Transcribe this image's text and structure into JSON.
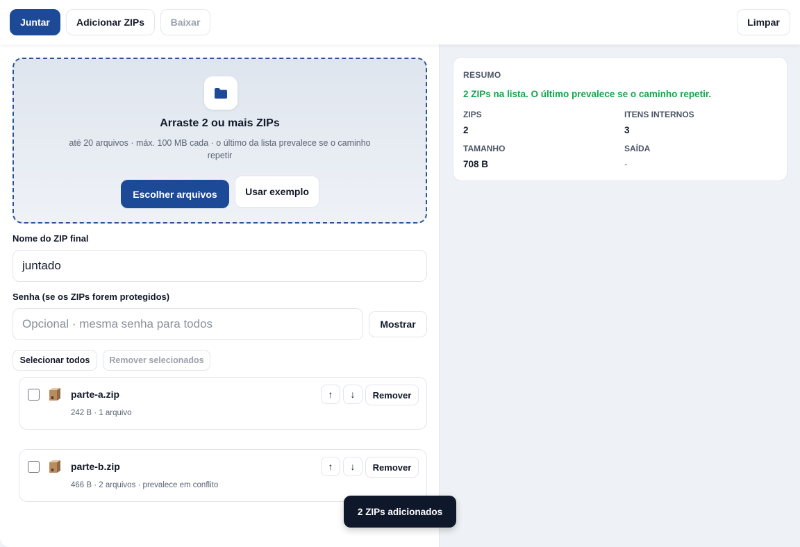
{
  "toolbar": {
    "merge_label": "Juntar",
    "add_zips_label": "Adicionar ZIPs",
    "download_label": "Baixar",
    "clear_label": "Limpar"
  },
  "dropzone": {
    "icon": "folder-icon",
    "title": "Arraste 2 ou mais ZIPs",
    "subtitle": "até 20 arquivos · máx. 100 MB cada · o último da lista prevalece se o caminho repetir",
    "choose_label": "Escolher arquivos",
    "example_label": "Usar exemplo"
  },
  "output_name": {
    "label": "Nome do ZIP final",
    "value": "juntado"
  },
  "password": {
    "label": "Senha (se os ZIPs forem protegidos)",
    "placeholder": "Opcional · mesma senha para todos",
    "show_label": "Mostrar"
  },
  "list_actions": {
    "select_all_label": "Selecionar todos",
    "remove_selected_label": "Remover selecionados"
  },
  "files": [
    {
      "name": "parte-a.zip",
      "meta": "242 B · 1 arquivo",
      "up": "↑",
      "down": "↓",
      "remove_label": "Remover",
      "checked": false
    },
    {
      "name": "parte-b.zip",
      "meta": "466 B · 2 arquivos · prevalece em conflito",
      "up": "↑",
      "down": "↓",
      "remove_label": "Remover",
      "checked": false
    }
  ],
  "summary": {
    "heading": "RESUMO",
    "status": "2 ZIPs na lista. O último prevalece se o caminho repetir.",
    "zips_label": "ZIPS",
    "zips_value": "2",
    "items_label": "ITENS INTERNOS",
    "items_value": "3",
    "size_label": "TAMANHO",
    "size_value": "708 B",
    "output_label": "SAÍDA",
    "output_value": "-"
  },
  "toast": {
    "message": "2 ZIPs adicionados"
  },
  "colors": {
    "primary": "#1d4a96",
    "success": "#16a34a",
    "toast_bg": "#0f172a"
  }
}
